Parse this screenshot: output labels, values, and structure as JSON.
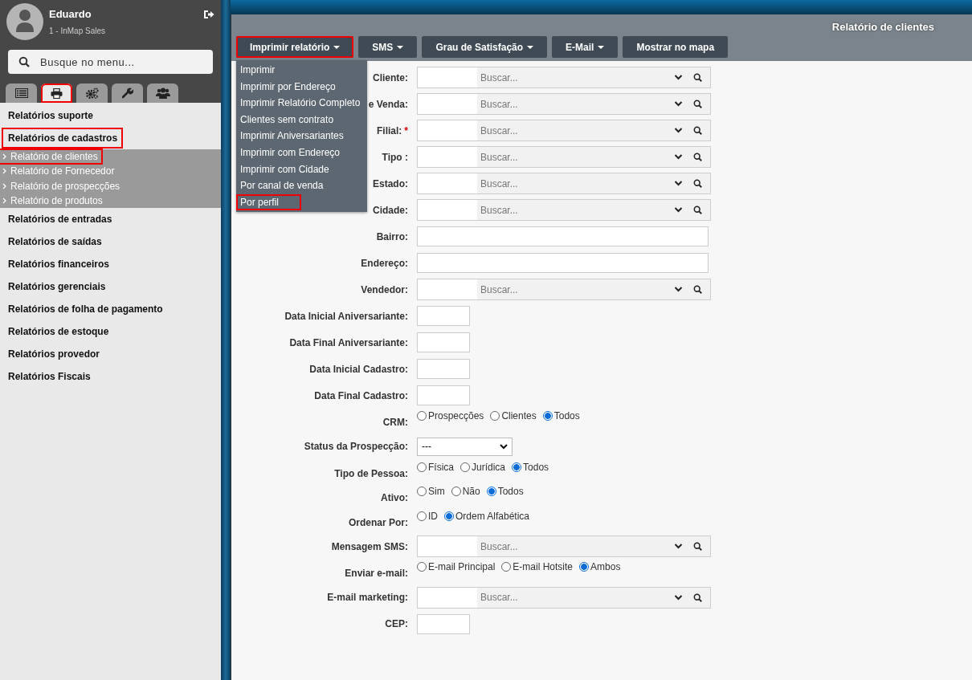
{
  "sidebar": {
    "user": {
      "name": "Eduardo",
      "subtitle": "1 - InMap Sales"
    },
    "search": {
      "placeholder": "Busque no menu..."
    },
    "tabs": [
      {
        "kind": "list",
        "selected": false,
        "highlighted": false
      },
      {
        "kind": "print",
        "selected": true,
        "highlighted": true
      },
      {
        "kind": "gears",
        "selected": false,
        "highlighted": false
      },
      {
        "kind": "wrench",
        "selected": false,
        "highlighted": false
      },
      {
        "kind": "users",
        "selected": false,
        "highlighted": false
      }
    ],
    "menu": [
      {
        "label": "Relatórios suporte",
        "highlighted": false
      },
      {
        "label": "Relatórios de cadastros",
        "highlighted": true,
        "children": [
          {
            "label": "Relatório de clientes",
            "highlighted": true
          },
          {
            "label": "Relatório de Fornecedor",
            "highlighted": false
          },
          {
            "label": "Relatório de prospecções",
            "highlighted": false
          },
          {
            "label": "Relatório de produtos",
            "highlighted": false
          }
        ]
      },
      {
        "label": "Relatórios de entradas",
        "highlighted": false
      },
      {
        "label": "Relatórios de saídas",
        "highlighted": false
      },
      {
        "label": "Relatórios financeiros",
        "highlighted": false
      },
      {
        "label": "Relatórios gerenciais",
        "highlighted": false
      },
      {
        "label": "Relatórios de folha de pagamento",
        "highlighted": false
      },
      {
        "label": "Relatórios de estoque",
        "highlighted": false
      },
      {
        "label": "Relatórios provedor",
        "highlighted": false
      },
      {
        "label": "Relatórios Fiscais",
        "highlighted": false
      }
    ]
  },
  "dialog": {
    "title": "Relatório de clientes",
    "toolbar": [
      {
        "label": "Imprimir relatório",
        "caret": true,
        "highlighted": true,
        "menu": [
          {
            "label": "Imprimir",
            "highlighted": false
          },
          {
            "label": "Imprimir por Endereço",
            "highlighted": false
          },
          {
            "label": "Imprimir Relatório Completo",
            "highlighted": false
          },
          {
            "label": "Clientes sem contrato",
            "highlighted": false
          },
          {
            "label": "Imprimir Aniversariantes",
            "highlighted": false
          },
          {
            "label": "Imprimir com Endereço",
            "highlighted": false
          },
          {
            "label": "Imprimir com Cidade",
            "highlighted": false
          },
          {
            "label": "Por canal de venda",
            "highlighted": false
          },
          {
            "label": "Por perfil",
            "highlighted": true
          }
        ]
      },
      {
        "label": "SMS",
        "caret": true,
        "highlighted": false
      },
      {
        "label": "Grau de Satisfação",
        "caret": true,
        "highlighted": false
      },
      {
        "label": "E-Mail",
        "caret": true,
        "highlighted": false
      },
      {
        "label": "Mostrar no mapa",
        "caret": false,
        "highlighted": false
      }
    ],
    "fields": [
      {
        "label": "Cliente:",
        "kind": "lookup",
        "placeholder": "Buscar..."
      },
      {
        "label": "e Venda:",
        "kind": "lookup",
        "placeholder": "Buscar..."
      },
      {
        "label": "Filial:",
        "required_mark": "*",
        "kind": "lookup",
        "placeholder": "Buscar..."
      },
      {
        "label": "Tipo :",
        "kind": "lookup",
        "placeholder": "Buscar..."
      },
      {
        "label": "Estado:",
        "kind": "lookup",
        "placeholder": "Buscar..."
      },
      {
        "label": "Cidade:",
        "kind": "lookup",
        "placeholder": "Buscar..."
      },
      {
        "label": "Bairro:",
        "kind": "text"
      },
      {
        "label": "Endereço:",
        "kind": "text"
      },
      {
        "label": "Vendedor:",
        "kind": "lookup",
        "placeholder": "Buscar..."
      },
      {
        "label": "Data Inicial Aniversariante:",
        "kind": "date"
      },
      {
        "label": "Data Final Aniversariante:",
        "kind": "date"
      },
      {
        "label": "Data Inicial Cadastro:",
        "kind": "date"
      },
      {
        "label": "Data Final Cadastro:",
        "kind": "date"
      },
      {
        "label": "CRM:",
        "kind": "radio",
        "options": [
          {
            "label": "Prospecções",
            "selected": false
          },
          {
            "label": "Clientes",
            "selected": false
          },
          {
            "label": "Todos",
            "selected": true
          }
        ]
      },
      {
        "label": "Status da Prospecção:",
        "kind": "select",
        "value": "---"
      },
      {
        "label": "Tipo de Pessoa:",
        "kind": "radio",
        "options": [
          {
            "label": "Física",
            "selected": false
          },
          {
            "label": "Jurídica",
            "selected": false
          },
          {
            "label": "Todos",
            "selected": true
          }
        ]
      },
      {
        "label": "Ativo:",
        "kind": "radio",
        "options": [
          {
            "label": "Sim",
            "selected": false
          },
          {
            "label": "Não",
            "selected": false
          },
          {
            "label": "Todos",
            "selected": true
          }
        ]
      },
      {
        "label": "Ordenar Por:",
        "kind": "radio",
        "options": [
          {
            "label": "ID",
            "selected": false
          },
          {
            "label": "Ordem Alfabética",
            "selected": true
          }
        ]
      },
      {
        "label": "Mensagem SMS:",
        "kind": "lookup",
        "placeholder": "Buscar..."
      },
      {
        "label": "Enviar e-mail:",
        "kind": "radio",
        "options": [
          {
            "label": "E-mail Principal",
            "selected": false
          },
          {
            "label": "E-mail Hotsite",
            "selected": false
          },
          {
            "label": "Ambos",
            "selected": true
          }
        ]
      },
      {
        "label": "E-mail marketing:",
        "kind": "lookup",
        "placeholder": "Buscar..."
      },
      {
        "label": "CEP:",
        "kind": "date"
      }
    ]
  }
}
